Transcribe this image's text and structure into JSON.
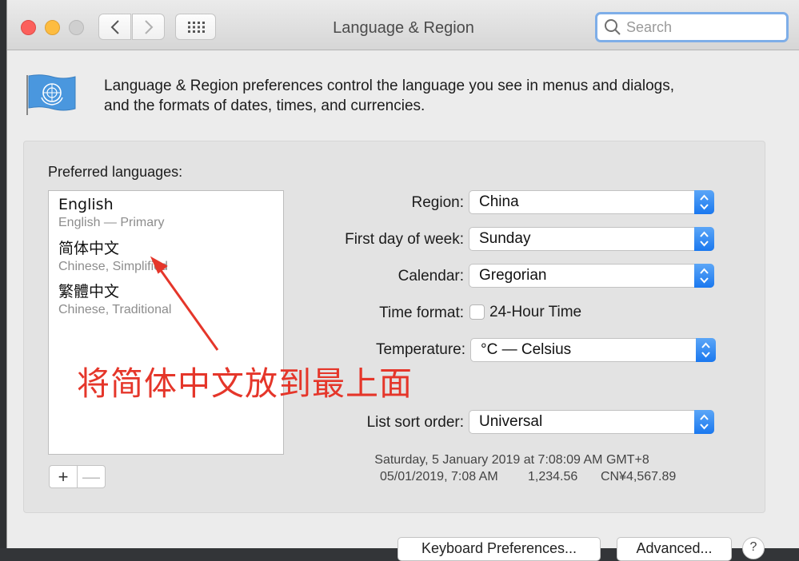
{
  "window": {
    "title": "Language & Region",
    "search_placeholder": "Search"
  },
  "header": {
    "description_line1": "Language & Region preferences control the language you see in menus and dialogs,",
    "description_line2": "and the formats of dates, times, and currencies."
  },
  "preferred_languages": {
    "label": "Preferred languages:",
    "items": [
      {
        "name": "English",
        "subtitle": "English — Primary"
      },
      {
        "name": "简体中文",
        "subtitle": "Chinese, Simplified"
      },
      {
        "name": "繁體中文",
        "subtitle": "Chinese, Traditional"
      }
    ],
    "add_symbol": "+",
    "remove_symbol": "—"
  },
  "settings": {
    "region": {
      "label": "Region:",
      "value": "China"
    },
    "first_day": {
      "label": "First day of week:",
      "value": "Sunday"
    },
    "calendar": {
      "label": "Calendar:",
      "value": "Gregorian"
    },
    "time_format": {
      "label": "Time format:",
      "checkbox_label": "24-Hour Time",
      "checked": false
    },
    "temperature": {
      "label": "Temperature:",
      "value": "°C — Celsius"
    },
    "list_sort": {
      "label": "List sort order:",
      "value": "Universal"
    }
  },
  "sample": {
    "line1": "Saturday, 5 January 2019 at 7:08:09 AM GMT+8",
    "date_short": "05/01/2019, 7:08 AM",
    "number": "1,234.56",
    "currency": "CN¥4,567.89"
  },
  "annotation": {
    "text": "将简体中文放到最上面",
    "color": "#e5362a"
  },
  "footer": {
    "keyboard_button": "Keyboard Preferences...",
    "advanced_button": "Advanced...",
    "help_button": "?"
  },
  "colors": {
    "accent": "#1a78ef",
    "search_focus": "#7eaee8"
  }
}
